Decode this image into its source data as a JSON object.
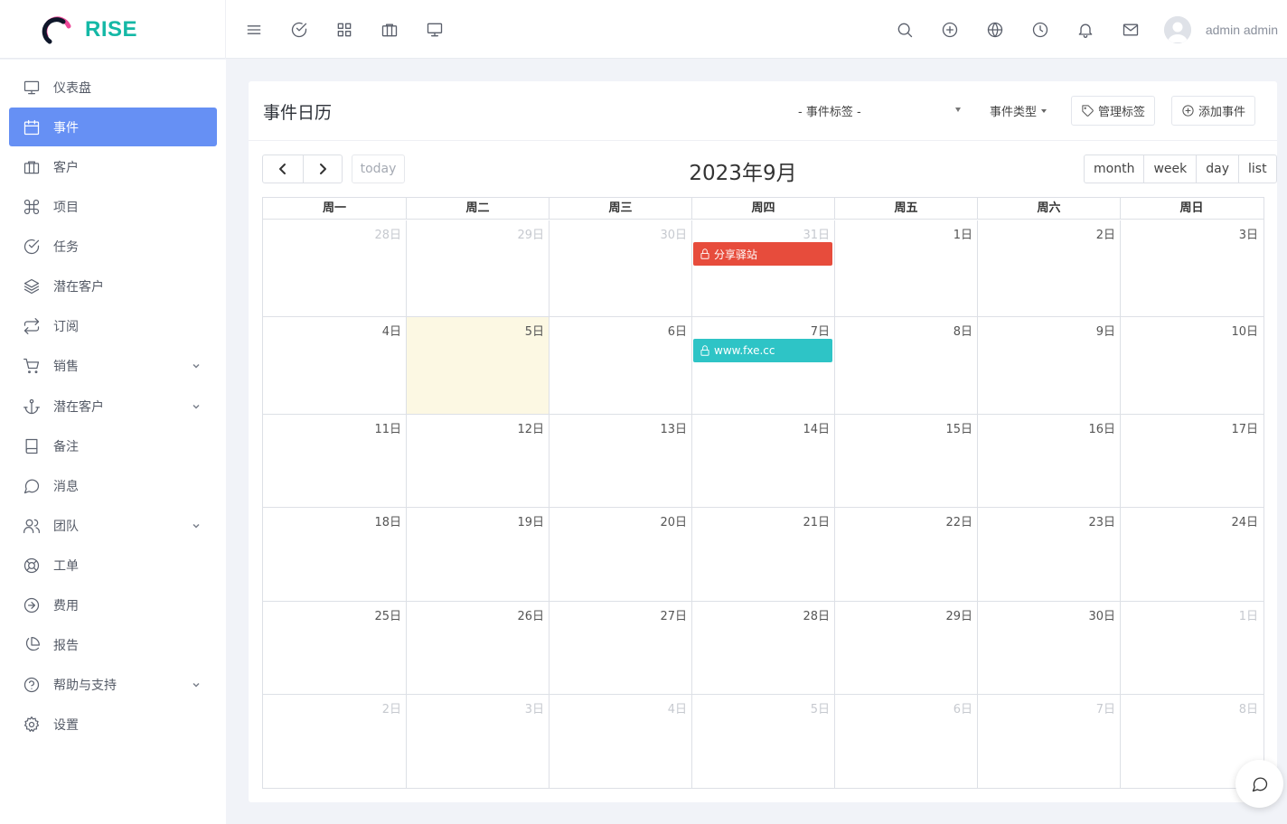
{
  "app": {
    "brand": "RISE"
  },
  "header": {
    "left_icons": [
      "menu-icon",
      "check-circle-icon",
      "grid-icon",
      "briefcase-icon",
      "monitor-icon"
    ],
    "right_icons": [
      "search-icon",
      "plus-circle-icon",
      "globe-icon",
      "clock-icon",
      "bell-icon",
      "mail-icon"
    ],
    "user_name": "admin admin"
  },
  "sidebar": {
    "items": [
      {
        "label": "仪表盘",
        "icon": "monitor-icon"
      },
      {
        "label": "事件",
        "icon": "calendar-icon",
        "active": true
      },
      {
        "label": "客户",
        "icon": "briefcase-icon"
      },
      {
        "label": "项目",
        "icon": "command-icon"
      },
      {
        "label": "任务",
        "icon": "check-circle-icon"
      },
      {
        "label": "潜在客户",
        "icon": "layers-icon"
      },
      {
        "label": "订阅",
        "icon": "repeat-icon"
      },
      {
        "label": "销售",
        "icon": "cart-icon",
        "has_submenu": true
      },
      {
        "label": "潜在客户",
        "icon": "anchor-icon",
        "has_submenu": true
      },
      {
        "label": "备注",
        "icon": "book-icon"
      },
      {
        "label": "消息",
        "icon": "message-icon"
      },
      {
        "label": "团队",
        "icon": "users-icon",
        "has_submenu": true
      },
      {
        "label": "工单",
        "icon": "life-buoy-icon"
      },
      {
        "label": "费用",
        "icon": "arrow-circle-icon"
      },
      {
        "label": "报告",
        "icon": "pie-chart-icon"
      },
      {
        "label": "帮助与支持",
        "icon": "help-circle-icon",
        "has_submenu": true
      },
      {
        "label": "设置",
        "icon": "settings-icon"
      }
    ]
  },
  "page": {
    "title": "事件日历",
    "tag_filter": {
      "value": "- 事件标签 -"
    },
    "type_dropdown": "事件类型",
    "manage_tags_label": "管理标签",
    "add_event_label": "添加事件"
  },
  "calendar": {
    "title": "2023年9月",
    "today_label": "today",
    "views": [
      "month",
      "week",
      "day",
      "list"
    ],
    "weekdays": [
      "周一",
      "周二",
      "周三",
      "周四",
      "周五",
      "周六",
      "周日"
    ],
    "weeks": [
      [
        "28日",
        "29日",
        "30日",
        "31日",
        "1日",
        "2日",
        "3日"
      ],
      [
        "4日",
        "5日",
        "6日",
        "7日",
        "8日",
        "9日",
        "10日"
      ],
      [
        "11日",
        "12日",
        "13日",
        "14日",
        "15日",
        "16日",
        "17日"
      ],
      [
        "18日",
        "19日",
        "20日",
        "21日",
        "22日",
        "23日",
        "24日"
      ],
      [
        "25日",
        "26日",
        "27日",
        "28日",
        "29日",
        "30日",
        "1日"
      ],
      [
        "2日",
        "3日",
        "4日",
        "5日",
        "6日",
        "7日",
        "8日"
      ]
    ],
    "other_month_cells": [
      [
        0,
        0
      ],
      [
        0,
        1
      ],
      [
        0,
        2
      ],
      [
        0,
        3
      ],
      [
        4,
        6
      ],
      [
        5,
        0
      ],
      [
        5,
        1
      ],
      [
        5,
        2
      ],
      [
        5,
        3
      ],
      [
        5,
        4
      ],
      [
        5,
        5
      ],
      [
        5,
        6
      ]
    ],
    "today_cell": [
      1,
      1
    ],
    "events": [
      {
        "title": "分享驿站",
        "week": 0,
        "day": 3,
        "color": "#e74c3c",
        "icon": "lock-icon"
      },
      {
        "title": "www.fxe.cc",
        "week": 1,
        "day": 3,
        "color": "#2ec4c6",
        "icon": "lock-icon"
      }
    ]
  },
  "colors": {
    "accent": "#6690f4",
    "brand": "#14b8a6",
    "today_bg": "#fcf8e3"
  }
}
